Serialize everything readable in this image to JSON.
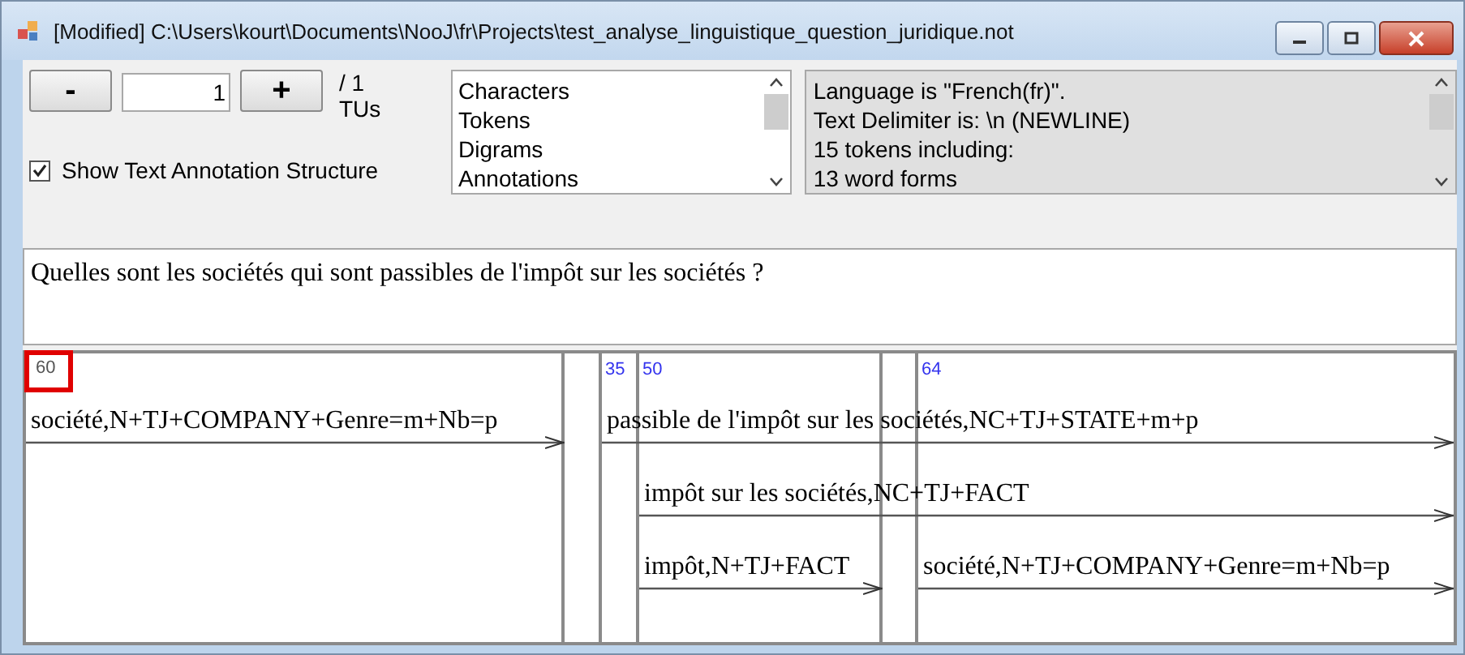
{
  "window": {
    "title": "[Modified] C:\\Users\\kourt\\Documents\\NooJ\\fr\\Projects\\test_analyse_linguistique_question_juridique.not"
  },
  "navigator": {
    "minus": "-",
    "value": "1",
    "plus": "+",
    "total": "/ 1",
    "unit": "TUs"
  },
  "show_structure": {
    "label": "Show Text Annotation Structure",
    "checked": true
  },
  "results_list": {
    "items": [
      "Characters",
      "Tokens",
      "Digrams",
      "Annotations"
    ]
  },
  "info_box": {
    "lines": [
      "Language is \"French(fr)\".",
      "Text Delimiter is: \\n (NEWLINE)",
      "15 tokens including:",
      "13 word forms"
    ]
  },
  "text": "Quelles sont les sociétés qui sont passibles de l'impôt sur les sociétés ?",
  "structure": {
    "columns": [
      {
        "label": "60",
        "highlighted": true
      },
      {},
      {
        "label": "35",
        "highlighted": false
      },
      {
        "label": "50",
        "highlighted": false
      },
      {},
      {
        "label": "64",
        "highlighted": false
      }
    ],
    "rows": [
      {
        "cells": [
          {
            "kind": "annotation",
            "text": "société,N+TJ+COMPANY+Genre=m+Nb=p",
            "to_end": false
          },
          {
            "kind": "gap"
          },
          {
            "kind": "annotation",
            "text": "passible de l'impôt sur les sociétés,NC+TJ+STATE+m+p",
            "to_end": true
          }
        ]
      },
      {
        "cells": [
          {
            "kind": "gap"
          },
          {
            "kind": "gap"
          },
          {
            "kind": "gap"
          },
          {
            "kind": "annotation",
            "text": "impôt sur les sociétés,NC+TJ+FACT",
            "to_end": true
          }
        ]
      },
      {
        "cells": [
          {
            "kind": "gap"
          },
          {
            "kind": "gap"
          },
          {
            "kind": "gap"
          },
          {
            "kind": "annotation",
            "text": "impôt,N+TJ+FACT",
            "to_end": false
          },
          {
            "kind": "gap"
          },
          {
            "kind": "annotation",
            "text": "société,N+TJ+COMPANY+Genre=m+Nb=p",
            "to_end": true
          }
        ]
      }
    ]
  }
}
